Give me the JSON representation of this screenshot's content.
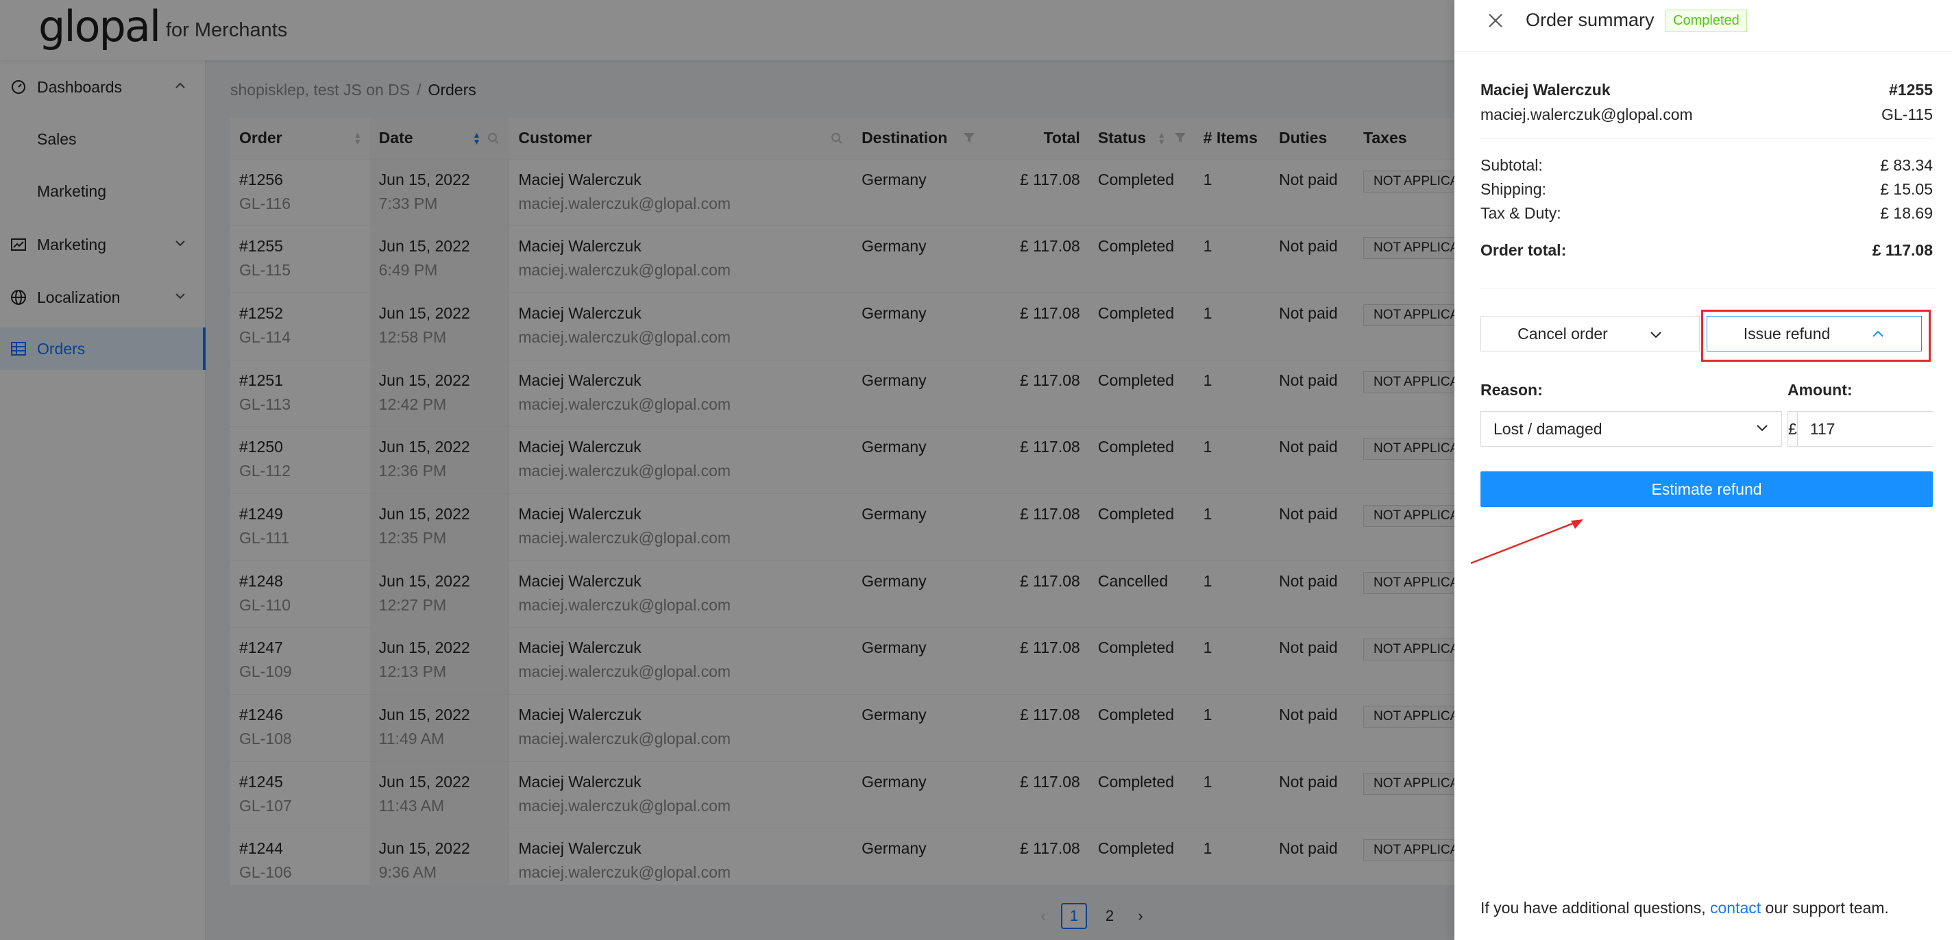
{
  "brand": {
    "logo": "glopal",
    "subtitle": "for Merchants"
  },
  "sidebar": {
    "items": [
      {
        "label": "Dashboards",
        "icon": "dashboard-icon",
        "expanded": true
      },
      {
        "label": "Sales"
      },
      {
        "label": "Marketing"
      },
      {
        "label": "Marketing",
        "icon": "chart-icon",
        "expanded": false
      },
      {
        "label": "Localization",
        "icon": "globe-icon",
        "expanded": false
      },
      {
        "label": "Orders",
        "icon": "table-icon",
        "active": true
      }
    ]
  },
  "breadcrumb": {
    "store": "shopisklep, test JS on DS",
    "separator": "/",
    "current": "Orders"
  },
  "table": {
    "columns": [
      "Order",
      "Date",
      "Customer",
      "Destination",
      "Total",
      "Status",
      "# Items",
      "Duties",
      "Taxes"
    ],
    "rows": [
      {
        "order": "#1256",
        "gl": "GL-116",
        "date": "Jun 15, 2022",
        "time": "7:33 PM",
        "name": "Maciej Walerczuk",
        "email": "maciej.walerczuk@glopal.com",
        "destination": "Germany",
        "total": "£ 117.08",
        "status": "Completed",
        "items": "1",
        "duties": "Not paid",
        "taxes": "NOT APPLICABLE TO EU"
      },
      {
        "order": "#1255",
        "gl": "GL-115",
        "date": "Jun 15, 2022",
        "time": "6:49 PM",
        "name": "Maciej Walerczuk",
        "email": "maciej.walerczuk@glopal.com",
        "destination": "Germany",
        "total": "£ 117.08",
        "status": "Completed",
        "items": "1",
        "duties": "Not paid",
        "taxes": "NOT APPLICABLE TO EU"
      },
      {
        "order": "#1252",
        "gl": "GL-114",
        "date": "Jun 15, 2022",
        "time": "12:58 PM",
        "name": "Maciej Walerczuk",
        "email": "maciej.walerczuk@glopal.com",
        "destination": "Germany",
        "total": "£ 117.08",
        "status": "Completed",
        "items": "1",
        "duties": "Not paid",
        "taxes": "NOT APPLICABLE TO EU"
      },
      {
        "order": "#1251",
        "gl": "GL-113",
        "date": "Jun 15, 2022",
        "time": "12:42 PM",
        "name": "Maciej Walerczuk",
        "email": "maciej.walerczuk@glopal.com",
        "destination": "Germany",
        "total": "£ 117.08",
        "status": "Completed",
        "items": "1",
        "duties": "Not paid",
        "taxes": "NOT APPLICABLE TO EU"
      },
      {
        "order": "#1250",
        "gl": "GL-112",
        "date": "Jun 15, 2022",
        "time": "12:36 PM",
        "name": "Maciej Walerczuk",
        "email": "maciej.walerczuk@glopal.com",
        "destination": "Germany",
        "total": "£ 117.08",
        "status": "Completed",
        "items": "1",
        "duties": "Not paid",
        "taxes": "NOT APPLICABLE TO EU"
      },
      {
        "order": "#1249",
        "gl": "GL-111",
        "date": "Jun 15, 2022",
        "time": "12:35 PM",
        "name": "Maciej Walerczuk",
        "email": "maciej.walerczuk@glopal.com",
        "destination": "Germany",
        "total": "£ 117.08",
        "status": "Completed",
        "items": "1",
        "duties": "Not paid",
        "taxes": "NOT APPLICABLE TO EU"
      },
      {
        "order": "#1248",
        "gl": "GL-110",
        "date": "Jun 15, 2022",
        "time": "12:27 PM",
        "name": "Maciej Walerczuk",
        "email": "maciej.walerczuk@glopal.com",
        "destination": "Germany",
        "total": "£ 117.08",
        "status": "Cancelled",
        "items": "1",
        "duties": "Not paid",
        "taxes": "NOT APPLICABLE TO EU"
      },
      {
        "order": "#1247",
        "gl": "GL-109",
        "date": "Jun 15, 2022",
        "time": "12:13 PM",
        "name": "Maciej Walerczuk",
        "email": "maciej.walerczuk@glopal.com",
        "destination": "Germany",
        "total": "£ 117.08",
        "status": "Completed",
        "items": "1",
        "duties": "Not paid",
        "taxes": "NOT APPLICABLE TO EU"
      },
      {
        "order": "#1246",
        "gl": "GL-108",
        "date": "Jun 15, 2022",
        "time": "11:49 AM",
        "name": "Maciej Walerczuk",
        "email": "maciej.walerczuk@glopal.com",
        "destination": "Germany",
        "total": "£ 117.08",
        "status": "Completed",
        "items": "1",
        "duties": "Not paid",
        "taxes": "NOT APPLICABLE TO EU"
      },
      {
        "order": "#1245",
        "gl": "GL-107",
        "date": "Jun 15, 2022",
        "time": "11:43 AM",
        "name": "Maciej Walerczuk",
        "email": "maciej.walerczuk@glopal.com",
        "destination": "Germany",
        "total": "£ 117.08",
        "status": "Completed",
        "items": "1",
        "duties": "Not paid",
        "taxes": "NOT APPLICABLE TO EU"
      },
      {
        "order": "#1244",
        "gl": "GL-106",
        "date": "Jun 15, 2022",
        "time": "9:36 AM",
        "name": "Maciej Walerczuk",
        "email": "maciej.walerczuk@glopal.com",
        "destination": "Germany",
        "total": "£ 117.08",
        "status": "Completed",
        "items": "1",
        "duties": "Not paid",
        "taxes": "NOT APPLICABLE TO EU"
      }
    ]
  },
  "pagination": {
    "pages": [
      "1",
      "2"
    ],
    "current": "1",
    "prev": "‹",
    "next": "›"
  },
  "drawer": {
    "title": "Order summary",
    "status": "Completed",
    "customer_name": "Maciej Walerczuk",
    "customer_email": "maciej.walerczuk@glopal.com",
    "order_number": "#1255",
    "gl_number": "GL-115",
    "subtotal_label": "Subtotal:",
    "subtotal": "£ 83.34",
    "shipping_label": "Shipping:",
    "shipping": "£ 15.05",
    "tax_label": "Tax & Duty:",
    "tax": "£ 18.69",
    "total_label": "Order total:",
    "total": "£ 117.08",
    "cancel_label": "Cancel order",
    "refund_label": "Issue refund",
    "reason_label": "Reason:",
    "reason_value": "Lost / damaged",
    "amount_label": "Amount:",
    "currency_symbol": "£",
    "amount_value": "117",
    "estimate_label": "Estimate refund",
    "footer_before": "If you have additional questions, ",
    "footer_link": "contact",
    "footer_after": " our support team."
  },
  "colors": {
    "primary": "#1890ff",
    "highlight": "#e5282b",
    "success": "#52c41a"
  }
}
